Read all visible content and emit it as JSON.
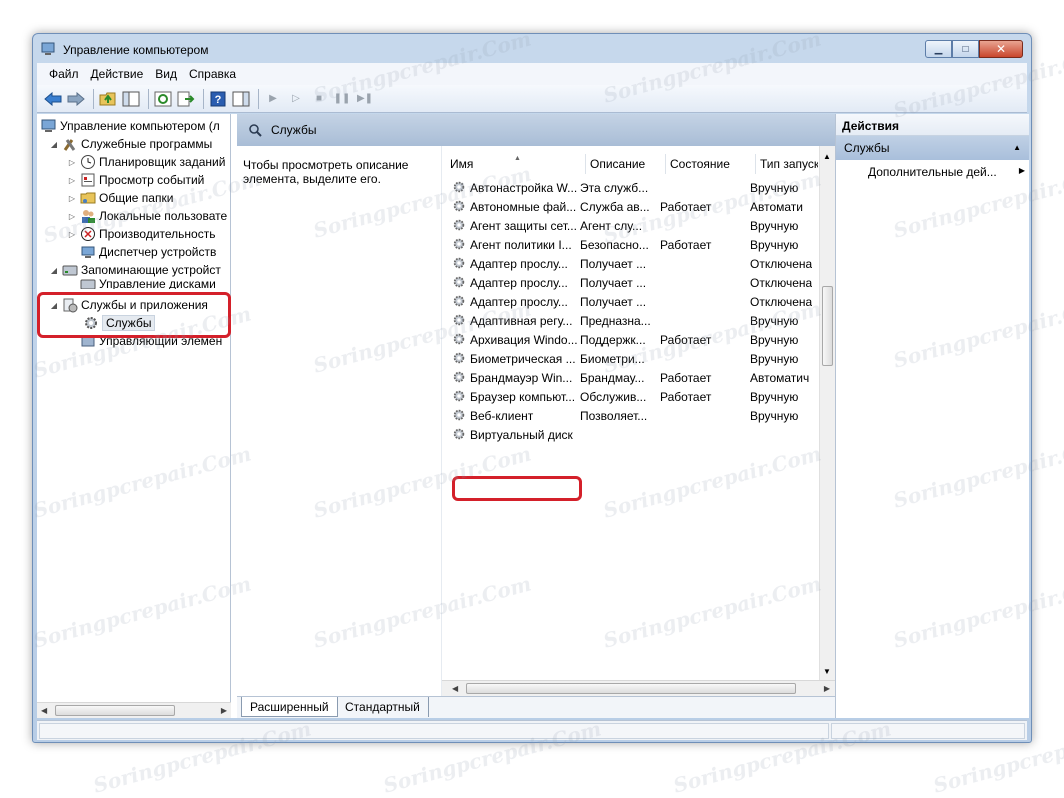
{
  "window": {
    "title": "Управление компьютером",
    "buttons": {
      "minimize": "▁",
      "maximize": "□",
      "close": "✕"
    }
  },
  "menu": [
    "Файл",
    "Действие",
    "Вид",
    "Справка"
  ],
  "tree": {
    "items": [
      {
        "label": "Управление компьютером (л",
        "icon": "computer-management-icon",
        "expander": ""
      },
      {
        "label": "Служебные программы",
        "icon": "tools-icon",
        "expander": "◢"
      },
      {
        "label": "Планировщик заданий",
        "icon": "clock-icon",
        "expander": "▷"
      },
      {
        "label": "Просмотр событий",
        "icon": "event-viewer-icon",
        "expander": "▷"
      },
      {
        "label": "Общие папки",
        "icon": "shared-folder-icon",
        "expander": "▷"
      },
      {
        "label": "Локальные пользовате",
        "icon": "users-icon",
        "expander": "▷"
      },
      {
        "label": "Производительность",
        "icon": "performance-icon",
        "expander": "▷"
      },
      {
        "label": "Диспетчер устройств",
        "icon": "device-manager-icon",
        "expander": ""
      },
      {
        "label": "Запоминающие устройст",
        "icon": "storage-icon",
        "expander": "◢"
      },
      {
        "label": "Управление дисками",
        "icon": "disk-icon",
        "expander": ""
      },
      {
        "label": "Службы и приложения",
        "icon": "services-apps-icon",
        "expander": "◢"
      },
      {
        "label": "Службы",
        "icon": "gear-icon",
        "expander": ""
      },
      {
        "label": "Управляющий элемен",
        "icon": "wmi-icon",
        "expander": ""
      }
    ]
  },
  "center": {
    "header": "Службы",
    "description": "Чтобы просмотреть описание элемента, выделите его.",
    "columns": [
      "Имя",
      "Описание",
      "Состояние",
      "Тип запуск"
    ],
    "rows": [
      [
        "Автонастройка W...",
        "Эта служб...",
        "",
        "Вручную"
      ],
      [
        "Автономные фай...",
        "Служба ав...",
        "Работает",
        "Автомати"
      ],
      [
        "Агент защиты сет...",
        "Агент слу...",
        "",
        "Вручную"
      ],
      [
        "Агент политики I...",
        "Безопасно...",
        "Работает",
        "Вручную"
      ],
      [
        "Адаптер прослу...",
        "Получает ...",
        "",
        "Отключена"
      ],
      [
        "Адаптер прослу...",
        "Получает ...",
        "",
        "Отключена"
      ],
      [
        "Адаптер прослу...",
        "Получает ...",
        "",
        "Отключена"
      ],
      [
        "Адаптивная регу...",
        "Предназна...",
        "",
        "Вручную"
      ],
      [
        "Архивация Windo...",
        "Поддержк...",
        "Работает",
        "Вручную"
      ],
      [
        "Биометрическая ...",
        "Биометри...",
        "",
        "Вручную"
      ],
      [
        "Брандмауэр Win...",
        "Брандмау...",
        "Работает",
        "Автоматич"
      ],
      [
        "Браузер компьют...",
        "Обслужив...",
        "Работает",
        "Вручную"
      ],
      [
        "Веб-клиент",
        "Позволяет...",
        "",
        "Вручную"
      ],
      [
        "Виртуальный диск",
        "",
        "",
        ""
      ]
    ],
    "tabs": [
      "Расширенный",
      "Стандартный"
    ]
  },
  "actions": {
    "header": "Действия",
    "section": "Службы",
    "items": [
      "Дополнительные дей..."
    ]
  },
  "watermark": "Soringpcrepair.Com"
}
